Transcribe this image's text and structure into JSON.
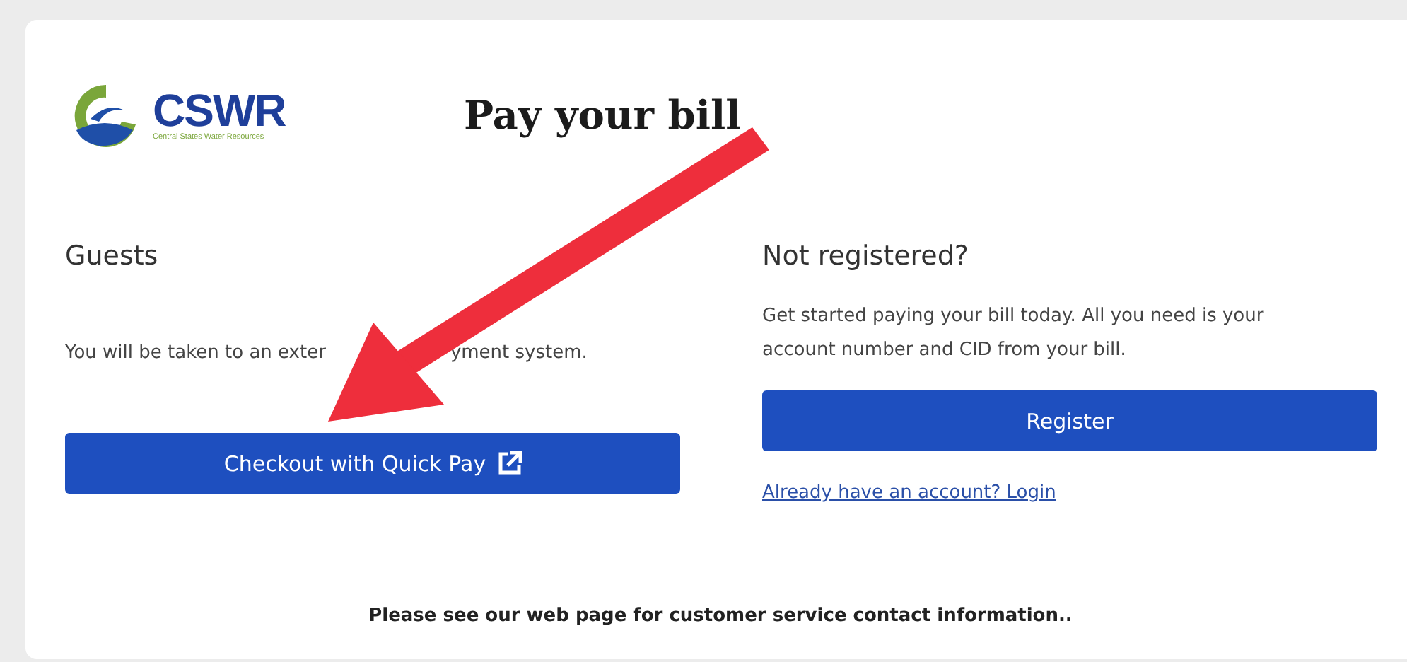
{
  "logo": {
    "name": "CSWR",
    "tagline": "Central States Water Resources"
  },
  "title": "Pay your bill",
  "guests": {
    "heading": "Guests",
    "text_parts": [
      "You will be taken to an exter",
      "yment system."
    ],
    "button": "Checkout with Quick Pay"
  },
  "register": {
    "heading": "Not registered?",
    "text": "Get started paying your bill today. All you need is your account number and CID from your bill.",
    "button": "Register",
    "link": "Already have an account? Login"
  },
  "footer": "Please see our web page for customer service contact information.."
}
